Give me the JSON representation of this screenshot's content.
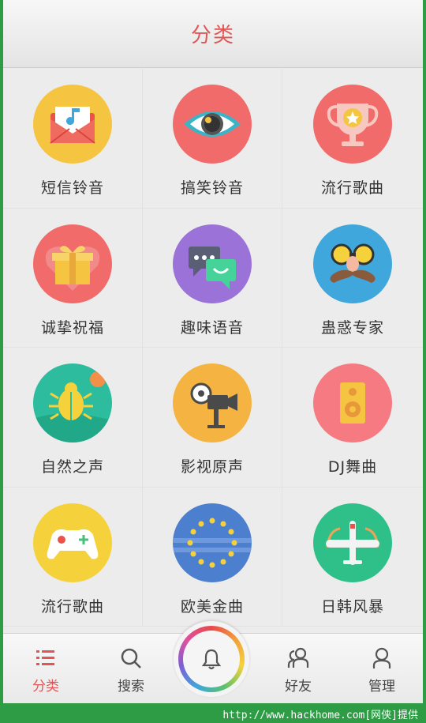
{
  "header": {
    "title": "分类"
  },
  "categories": [
    {
      "label": "短信铃音",
      "icon": "envelope-music-icon",
      "color": "#f5c542"
    },
    {
      "label": "搞笑铃音",
      "icon": "eye-icon",
      "color": "#f26b6b"
    },
    {
      "label": "流行歌曲",
      "icon": "trophy-icon",
      "color": "#f26b6b"
    },
    {
      "label": "诚挚祝福",
      "icon": "gift-icon",
      "color": "#f26b6b"
    },
    {
      "label": "趣味语音",
      "icon": "chat-bubbles-icon",
      "color": "#9b72d8"
    },
    {
      "label": "蛊惑专家",
      "icon": "mustache-glasses-icon",
      "color": "#3fa7dc"
    },
    {
      "label": "自然之声",
      "icon": "beetle-icon",
      "color": "#2dbd9e"
    },
    {
      "label": "影视原声",
      "icon": "movie-camera-icon",
      "color": "#f5b342"
    },
    {
      "label": "DJ舞曲",
      "icon": "speaker-icon",
      "color": "#f57a82"
    },
    {
      "label": "流行歌曲",
      "icon": "gamepad-icon",
      "color": "#f5d23c"
    },
    {
      "label": "欧美金曲",
      "icon": "eu-flag-icon",
      "color": "#4d7fcf"
    },
    {
      "label": "日韩风暴",
      "icon": "airplane-icon",
      "color": "#2fc08a"
    }
  ],
  "tabbar": {
    "items": [
      {
        "label": "分类",
        "icon": "list-icon"
      },
      {
        "label": "搜索",
        "icon": "search-icon"
      },
      {
        "label": "好友",
        "icon": "friends-icon"
      },
      {
        "label": "管理",
        "icon": "user-icon"
      }
    ],
    "center_icon": "bell-icon"
  },
  "footer": {
    "url_text": "http://www.hackhome.com[网侠]提供"
  }
}
